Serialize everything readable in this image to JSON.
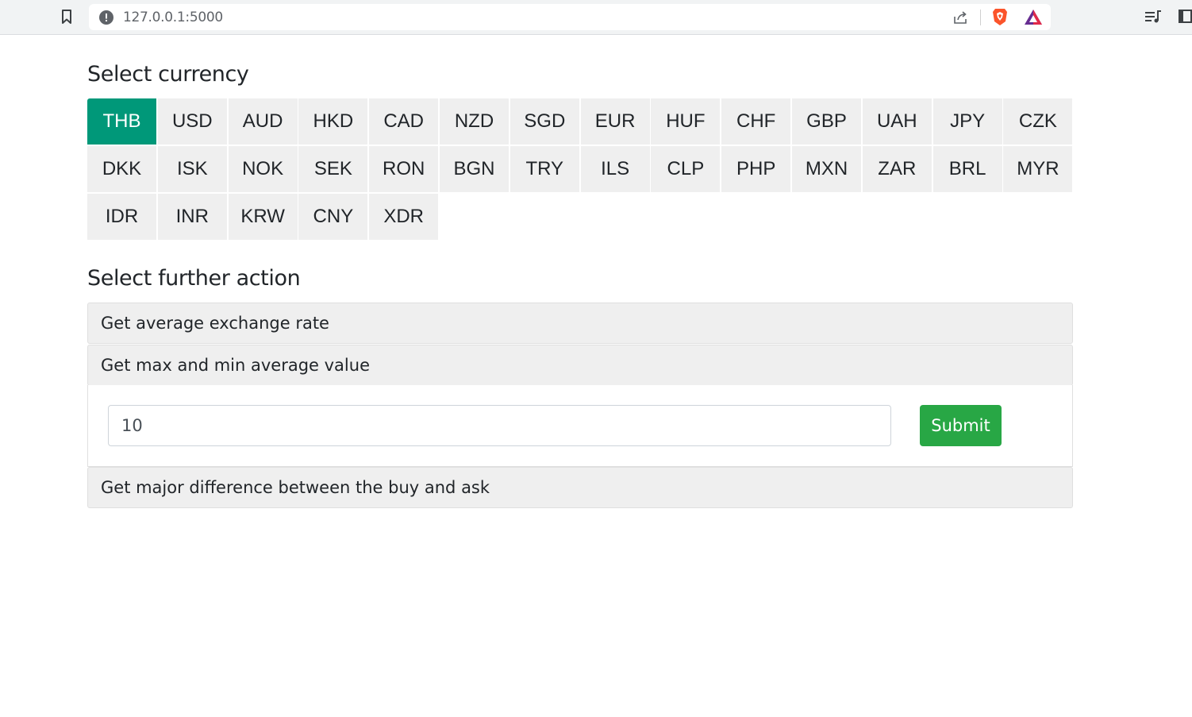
{
  "browser": {
    "url": "127.0.0.1:5000",
    "icons": [
      "bookmark-icon",
      "info-icon",
      "share-icon",
      "brave-shield-icon",
      "brave-rewards-icon",
      "playlist-icon",
      "sidebar-icon"
    ]
  },
  "currency_section": {
    "title": "Select currency",
    "selected": "THB",
    "rows": [
      [
        "THB",
        "USD",
        "AUD",
        "HKD",
        "CAD",
        "NZD",
        "SGD",
        "EUR",
        "HUF",
        "CHF",
        "GBP",
        "UAH",
        "JPY",
        "CZK"
      ],
      [
        "DKK",
        "ISK",
        "NOK",
        "SEK",
        "RON",
        "BGN",
        "TRY",
        "ILS",
        "CLP",
        "PHP",
        "MXN",
        "ZAR",
        "BRL",
        "MYR"
      ],
      [
        "IDR",
        "INR",
        "KRW",
        "CNY",
        "XDR"
      ]
    ]
  },
  "action_section": {
    "title": "Select further action",
    "actions": [
      {
        "label": "Get average exchange rate"
      },
      {
        "label": "Get max and min average value"
      },
      {
        "label": "Get major difference between the buy and ask"
      }
    ],
    "expanded_index": 1,
    "input_value": "10",
    "submit_label": "Submit"
  },
  "colors": {
    "accent_selected": "#009879",
    "submit_green": "#28a745",
    "button_gray": "#efefef"
  }
}
